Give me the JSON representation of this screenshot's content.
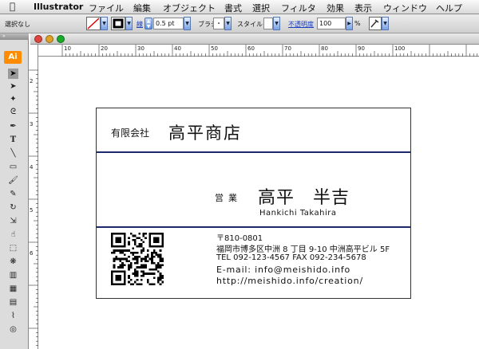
{
  "menubar": {
    "app": "Illustrator",
    "items": [
      "ファイル",
      "編集",
      "オブジェクト",
      "書式",
      "選択",
      "フィルタ",
      "効果",
      "表示",
      "ウィンドウ",
      "ヘルプ"
    ]
  },
  "controlbar": {
    "selection_label": "選択なし",
    "stroke_link": "線",
    "stroke_width": "0.5 pt",
    "brush_label": "ブラシ",
    "brush_value": "・",
    "style_label": "スタイル",
    "opacity_link": "不透明度",
    "opacity_value": "100",
    "percent": "%"
  },
  "toolbox": {
    "logo": "Ai",
    "tools": [
      "selection-tool",
      "direct-selection-tool",
      "magic-wand-tool",
      "lasso-tool",
      "pen-tool",
      "type-tool",
      "line-tool",
      "rectangle-tool",
      "paintbrush-tool",
      "pencil-tool",
      "rotate-tool",
      "scale-tool",
      "warp-tool",
      "free-transform-tool",
      "symbol-sprayer-tool",
      "column-graph-tool",
      "mesh-tool",
      "gradient-tool",
      "eyedropper-tool",
      "blend-tool"
    ]
  },
  "rulers": {
    "horizontal": [
      "10",
      "20",
      "30",
      "40",
      "50",
      "60",
      "70",
      "80",
      "90",
      "100"
    ],
    "vertical": [
      "2",
      "3",
      "4",
      "5",
      "6"
    ]
  },
  "card": {
    "company_prefix": "有限会社",
    "company_name": "高平商店",
    "title": "営業",
    "name": "高平　半吉",
    "romaji": "Hankichi  Takahira",
    "postal": "〒810-0801",
    "address": "福岡市博多区中洲 8 丁目 9-10 中洲高平ビル 5F",
    "tel_fax": "TEL 092-123-4567  FAX 092-234-5678",
    "email": "E-mail: info@meishido.info",
    "url": "http://meishido.info/creation/"
  },
  "colors": {
    "card_rule": "#1c2a6b",
    "ai_logo": "#ff8c00"
  }
}
